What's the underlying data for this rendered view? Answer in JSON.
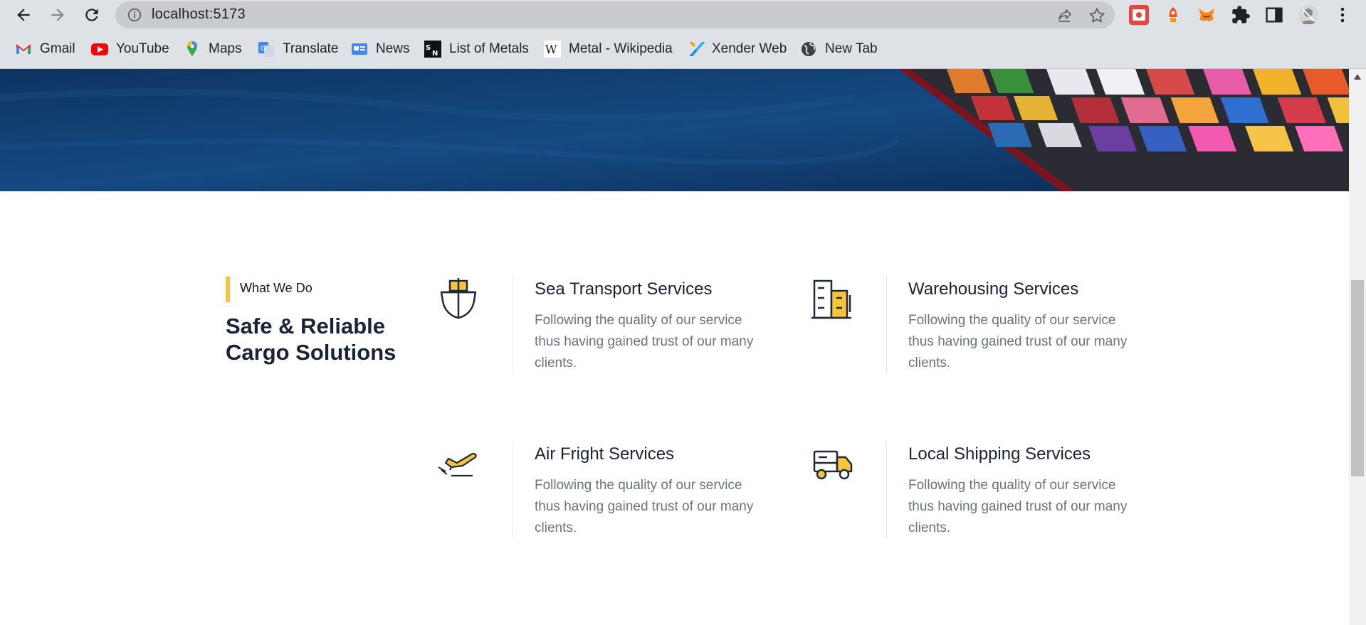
{
  "browser": {
    "url": "localhost:5173",
    "bookmarks": [
      {
        "label": "Gmail",
        "icon": "gmail-icon"
      },
      {
        "label": "YouTube",
        "icon": "youtube-icon"
      },
      {
        "label": "Maps",
        "icon": "maps-icon"
      },
      {
        "label": "Translate",
        "icon": "translate-icon"
      },
      {
        "label": "News",
        "icon": "news-icon"
      },
      {
        "label": "List of Metals",
        "icon": "sn-icon"
      },
      {
        "label": "Metal - Wikipedia",
        "icon": "wikipedia-icon"
      },
      {
        "label": "Xender Web",
        "icon": "xender-icon"
      },
      {
        "label": "New Tab",
        "icon": "globe-icon"
      }
    ]
  },
  "section": {
    "tag": "What We Do",
    "heading": "Safe & Reliable Cargo Solutions",
    "accent_color": "#f9c43b"
  },
  "services": [
    {
      "title": "Sea Transport Services",
      "description": "Following the quality of our service thus having gained trust of our many clients.",
      "icon": "ship-icon"
    },
    {
      "title": "Warehousing Services",
      "description": "Following the quality of our service thus having gained trust of our many clients.",
      "icon": "warehouse-icon"
    },
    {
      "title": "Air Fright Services",
      "description": "Following the quality of our service thus having gained trust of our many clients.",
      "icon": "airplane-icon"
    },
    {
      "title": "Local Shipping Services",
      "description": "Following the quality of our service thus having gained trust of our many clients.",
      "icon": "truck-icon"
    }
  ]
}
